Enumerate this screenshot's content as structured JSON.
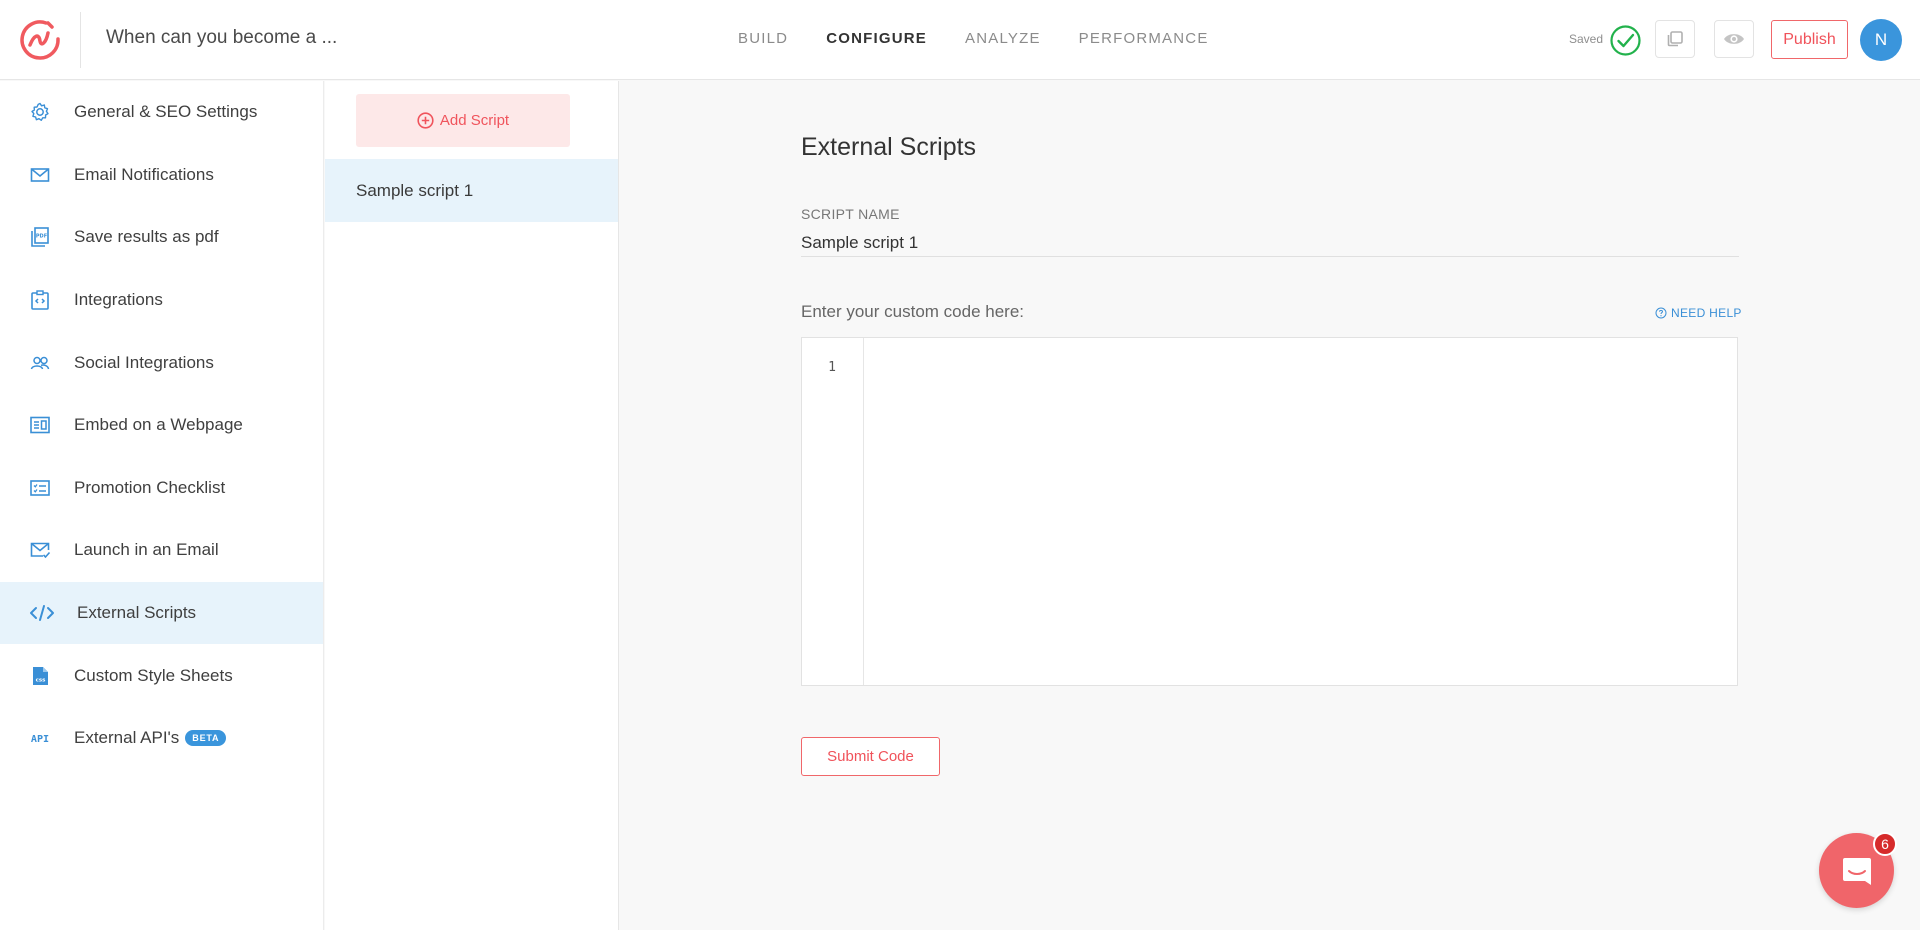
{
  "header": {
    "doc_title": "When can you become a ...",
    "tabs": [
      {
        "label": "BUILD",
        "active": false
      },
      {
        "label": "CONFIGURE",
        "active": true
      },
      {
        "label": "ANALYZE",
        "active": false
      },
      {
        "label": "PERFORMANCE",
        "active": false
      }
    ],
    "saved_label": "Saved",
    "publish_label": "Publish",
    "avatar_initial": "N",
    "icons": {
      "logo": "brand-logo-icon",
      "saved": "check-circle-icon",
      "copy": "copy-icon",
      "preview": "eye-icon"
    }
  },
  "sidebar": {
    "items": [
      {
        "label": "General & SEO Settings",
        "icon": "gear-icon"
      },
      {
        "label": "Email Notifications",
        "icon": "envelope-icon"
      },
      {
        "label": "Save results as pdf",
        "icon": "pdf-icon"
      },
      {
        "label": "Integrations",
        "icon": "integrations-icon"
      },
      {
        "label": "Social Integrations",
        "icon": "users-icon"
      },
      {
        "label": "Embed on a Webpage",
        "icon": "embed-icon"
      },
      {
        "label": "Promotion Checklist",
        "icon": "checklist-icon"
      },
      {
        "label": "Launch in an Email",
        "icon": "email-check-icon"
      },
      {
        "label": "External Scripts",
        "icon": "code-icon",
        "active": true
      },
      {
        "label": "Custom Style Sheets",
        "icon": "css-file-icon"
      },
      {
        "label": "External API's",
        "icon": "api-icon",
        "badge": "BETA"
      }
    ]
  },
  "scripts": {
    "add_label": "Add Script",
    "items": [
      "Sample script 1"
    ]
  },
  "main": {
    "title": "External Scripts",
    "script_name_label": "SCRIPT NAME",
    "script_name_value": "Sample script 1",
    "code_label": "Enter your custom code here:",
    "need_help_label": "NEED HELP",
    "line_number": "1",
    "code_value": "",
    "submit_label": "Submit Code"
  },
  "chat": {
    "badge_count": "6"
  },
  "colors": {
    "accent_red": "#f0525a",
    "accent_blue": "#3a95dc",
    "active_bg": "#e7f3fb",
    "add_bg": "#fde8e8"
  }
}
